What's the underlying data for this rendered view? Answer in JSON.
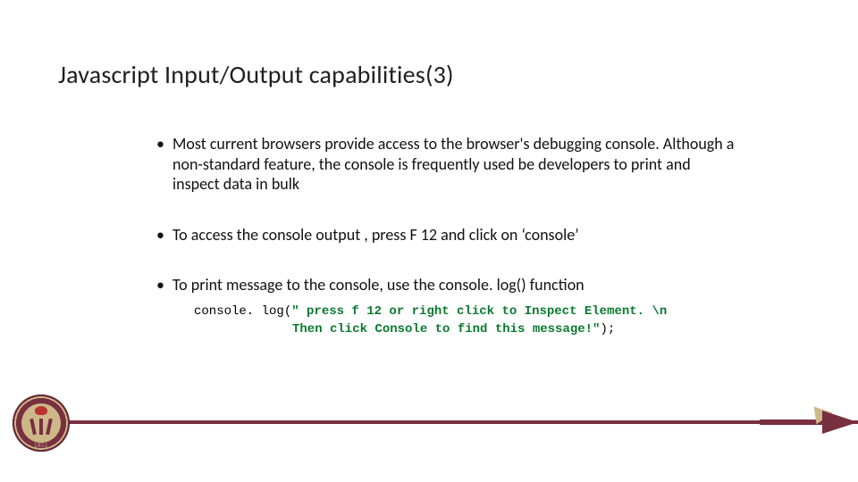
{
  "title": "Javascript Input/Output capabilities(3)",
  "bullets": {
    "b1": "Most current browsers provide access to the browser's debugging console. Although a non-standard feature, the console is frequently used be developers to print and inspect data in bulk",
    "b2": "To access the console output , press F 12 and click on ‘console’",
    "b3": "To print message to the console, use the console. log() function"
  },
  "code": {
    "prefix": "console. log(",
    "str1": "\" press f 12 or right click to Inspect Element. \\n",
    "str2": "Then click Console to find this message!\"",
    "suffix": ");"
  },
  "seal": {
    "year": "1851"
  }
}
